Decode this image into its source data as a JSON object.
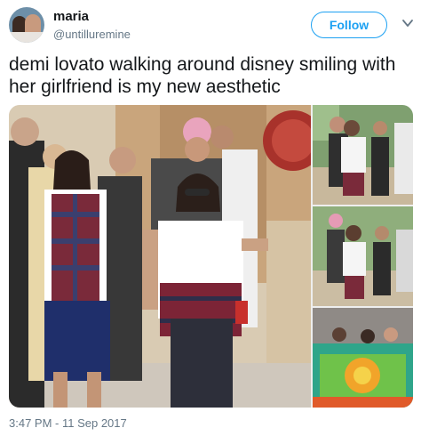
{
  "tweet": {
    "display_name": "maria",
    "handle": "@untilluremine",
    "follow_label": "Follow",
    "text": "demi lovato walking around disney smiling with her girlfriend is my new aesthetic",
    "timestamp": "3:47 PM - 11 Sep 2017"
  },
  "icons": {
    "caret": "chevron-down-icon"
  },
  "colors": {
    "accent": "#1da1f2",
    "text": "#14171a",
    "secondary_text": "#657786"
  }
}
